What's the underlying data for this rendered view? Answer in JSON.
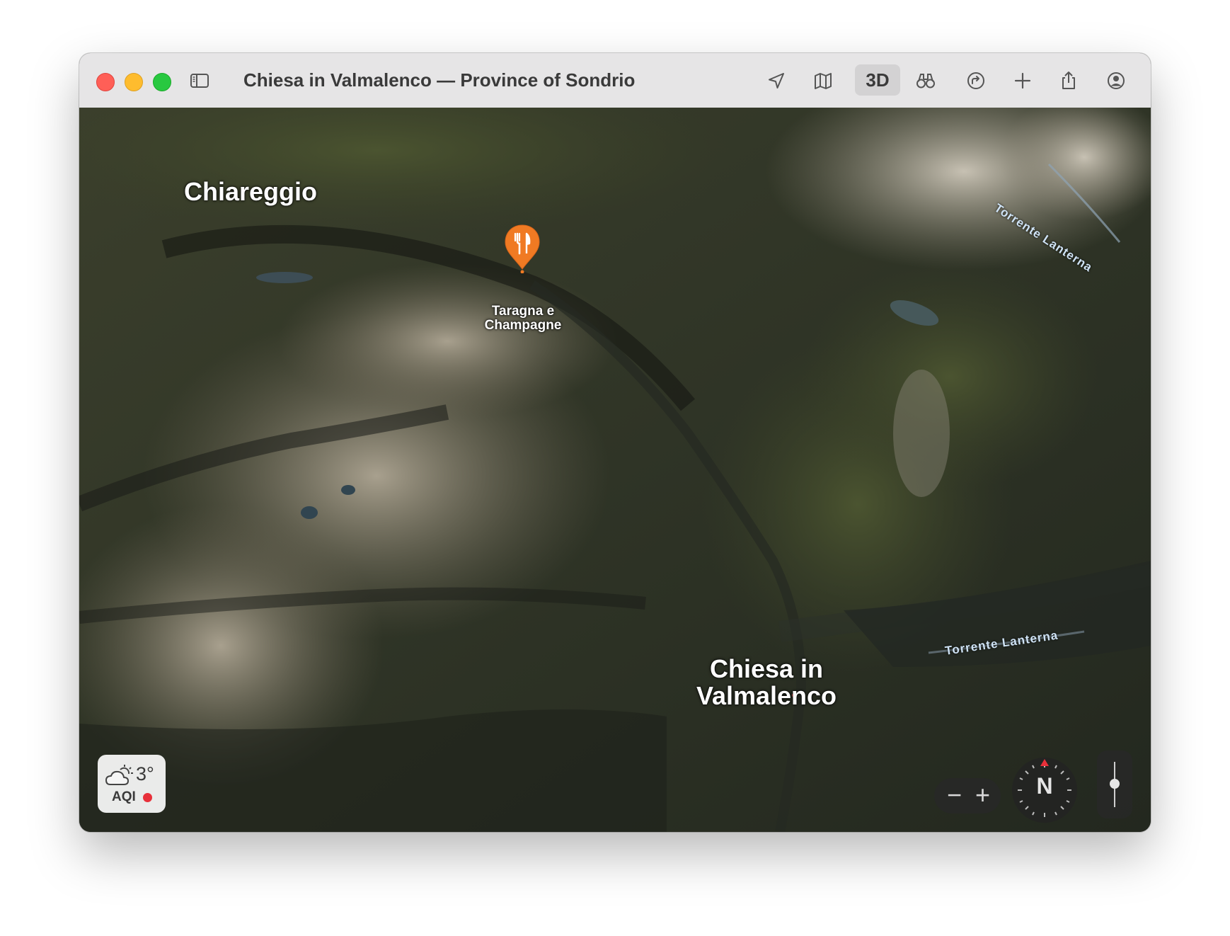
{
  "window": {
    "title": "Chiesa in Valmalenco — Province of Sondrio"
  },
  "toolbar": {
    "sidebar_icon": "sidebar-icon",
    "location_icon": "location-arrow-icon",
    "map_mode_icon": "map-icon",
    "view_3d_label": "3D",
    "look_around_icon": "binoculars-icon",
    "directions_icon": "directions-icon",
    "add_icon": "plus-icon",
    "share_icon": "share-icon",
    "account_icon": "account-icon"
  },
  "map": {
    "places": [
      {
        "name": "Chiareggio"
      },
      {
        "name": "Chiesa in\nValmalenco"
      }
    ],
    "rivers": [
      "Torrente Lanterna",
      "Torrente Lanterna"
    ],
    "poi": {
      "name": "Taragna e\nChampagne",
      "icon": "fork-knife-icon",
      "color": "#f07a23"
    }
  },
  "weather": {
    "icon": "partly-cloudy-icon",
    "temperature": "3°",
    "aqi_label": "AQI",
    "aqi_color": "#e8303a"
  },
  "controls": {
    "zoom_out": "−",
    "zoom_in": "+",
    "compass_label": "N",
    "compass_accent": "#e8303a"
  }
}
